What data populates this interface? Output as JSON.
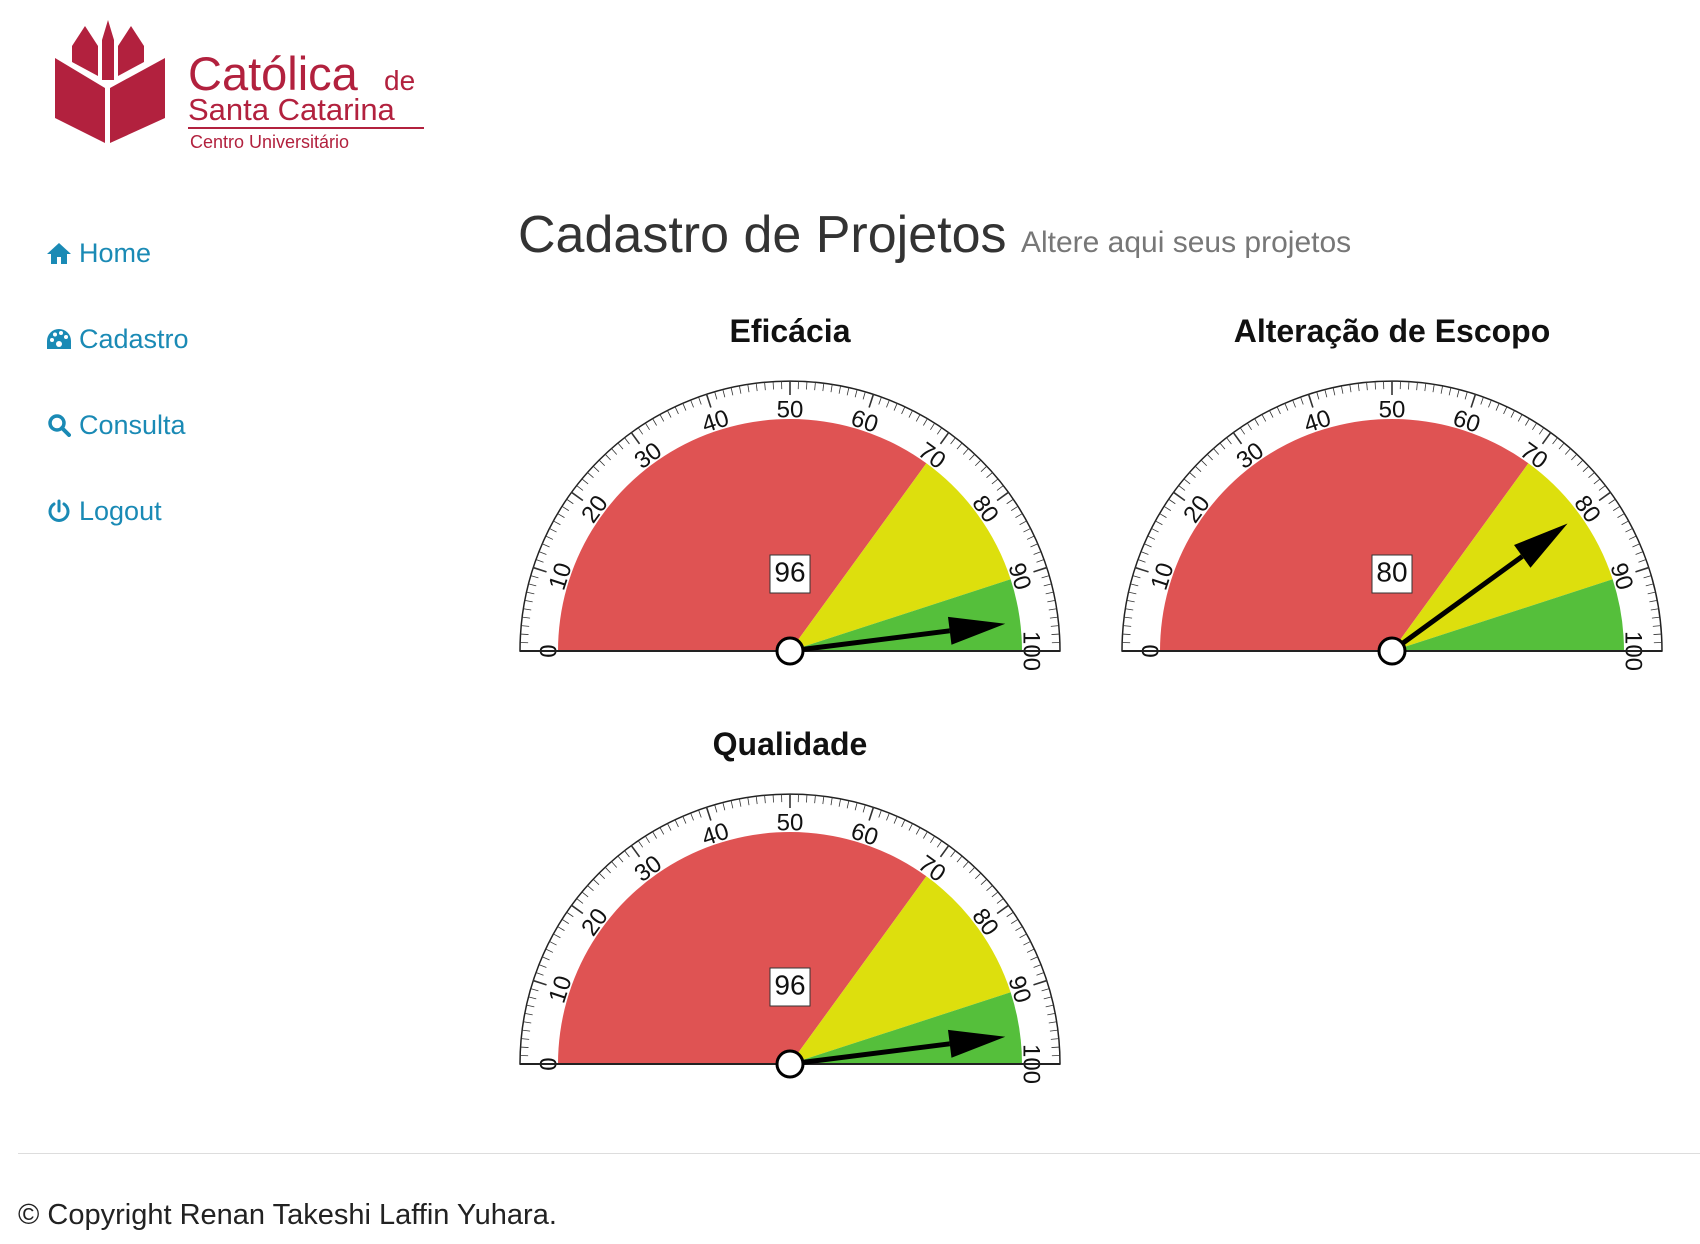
{
  "brand": {
    "name_line1": "Católica",
    "name_de": "de",
    "name_line2": "Santa Catarina",
    "name_line3": "Centro Universitário",
    "color": "#b2213e"
  },
  "nav": {
    "items": [
      {
        "label": "Home",
        "icon": "home-icon"
      },
      {
        "label": "Cadastro",
        "icon": "dashboard-icon"
      },
      {
        "label": "Consulta",
        "icon": "search-icon"
      },
      {
        "label": "Logout",
        "icon": "power-icon"
      }
    ],
    "link_color": "#1a8ab5"
  },
  "header": {
    "title": "Cadastro de Projetos",
    "subtitle": "Altere aqui seus projetos"
  },
  "chart_data": [
    {
      "type": "gauge",
      "title": "Eficácia",
      "value": 96,
      "min": 0,
      "max": 100,
      "tick_labels": [
        "0",
        "10",
        "20",
        "30",
        "40",
        "50",
        "60",
        "70",
        "80",
        "90",
        "100"
      ],
      "bands": [
        {
          "from": 0,
          "to": 70,
          "color": "#df5353"
        },
        {
          "from": 70,
          "to": 90,
          "color": "#dddf0d"
        },
        {
          "from": 90,
          "to": 100,
          "color": "#55bf3b"
        }
      ]
    },
    {
      "type": "gauge",
      "title": "Alteração de Escopo",
      "value": 80,
      "min": 0,
      "max": 100,
      "tick_labels": [
        "0",
        "10",
        "20",
        "30",
        "40",
        "50",
        "60",
        "70",
        "80",
        "90",
        "100"
      ],
      "bands": [
        {
          "from": 0,
          "to": 70,
          "color": "#df5353"
        },
        {
          "from": 70,
          "to": 90,
          "color": "#dddf0d"
        },
        {
          "from": 90,
          "to": 100,
          "color": "#55bf3b"
        }
      ]
    },
    {
      "type": "gauge",
      "title": "Qualidade",
      "value": 96,
      "min": 0,
      "max": 100,
      "tick_labels": [
        "0",
        "10",
        "20",
        "30",
        "40",
        "50",
        "60",
        "70",
        "80",
        "90",
        "100"
      ],
      "bands": [
        {
          "from": 0,
          "to": 70,
          "color": "#df5353"
        },
        {
          "from": 70,
          "to": 90,
          "color": "#dddf0d"
        },
        {
          "from": 90,
          "to": 100,
          "color": "#55bf3b"
        }
      ]
    }
  ],
  "footer": {
    "copyright": "© Copyright Renan Takeshi Laffin Yuhara."
  }
}
